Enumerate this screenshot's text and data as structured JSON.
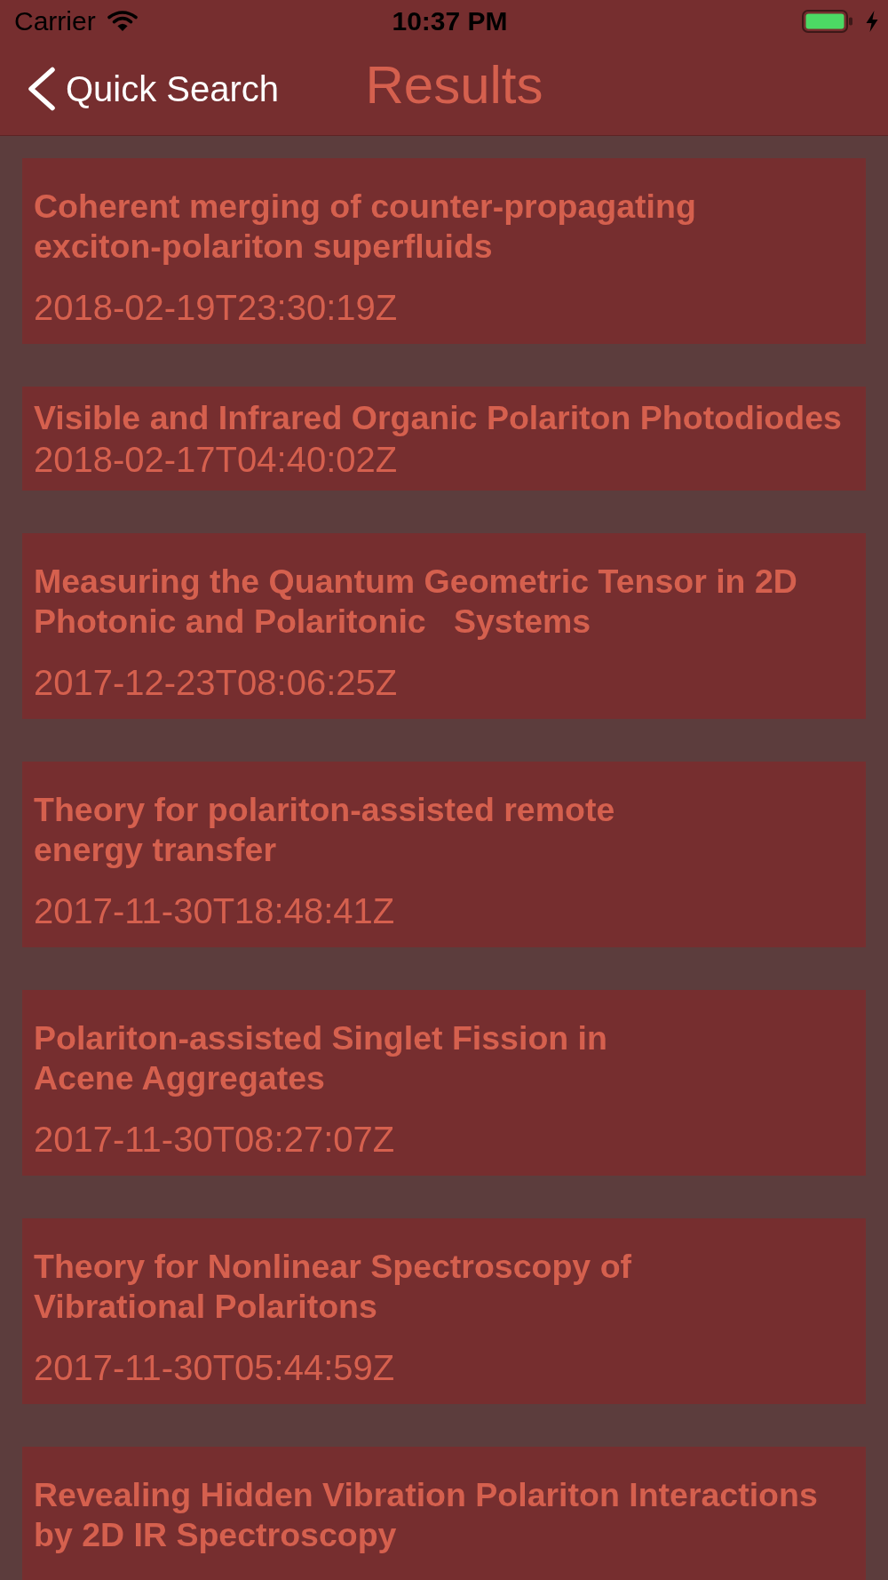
{
  "status_bar": {
    "carrier": "Carrier",
    "time": "10:37 PM",
    "charging": true
  },
  "nav_bar": {
    "back_label": "Quick Search",
    "title": "Results"
  },
  "results": [
    {
      "title": "Coherent merging of counter-propagating\nexciton-polariton superfluids",
      "date": "2018-02-19T23:30:19Z"
    },
    {
      "title": "Visible and Infrared Organic Polariton Photodiodes",
      "date": "2018-02-17T04:40:02Z"
    },
    {
      "title": "Measuring the Quantum Geometric Tensor in 2D\nPhotonic and Polaritonic   Systems",
      "date": "2017-12-23T08:06:25Z"
    },
    {
      "title": "Theory for polariton-assisted remote\nenergy transfer",
      "date": "2017-11-30T18:48:41Z"
    },
    {
      "title": "Polariton-assisted Singlet Fission in\nAcene Aggregates",
      "date": "2017-11-30T08:27:07Z"
    },
    {
      "title": "Theory for Nonlinear Spectroscopy of\nVibrational Polaritons",
      "date": "2017-11-30T05:44:59Z"
    },
    {
      "title": "Revealing Hidden Vibration Polariton Interactions\nby 2D IR Spectroscopy"
    }
  ]
}
